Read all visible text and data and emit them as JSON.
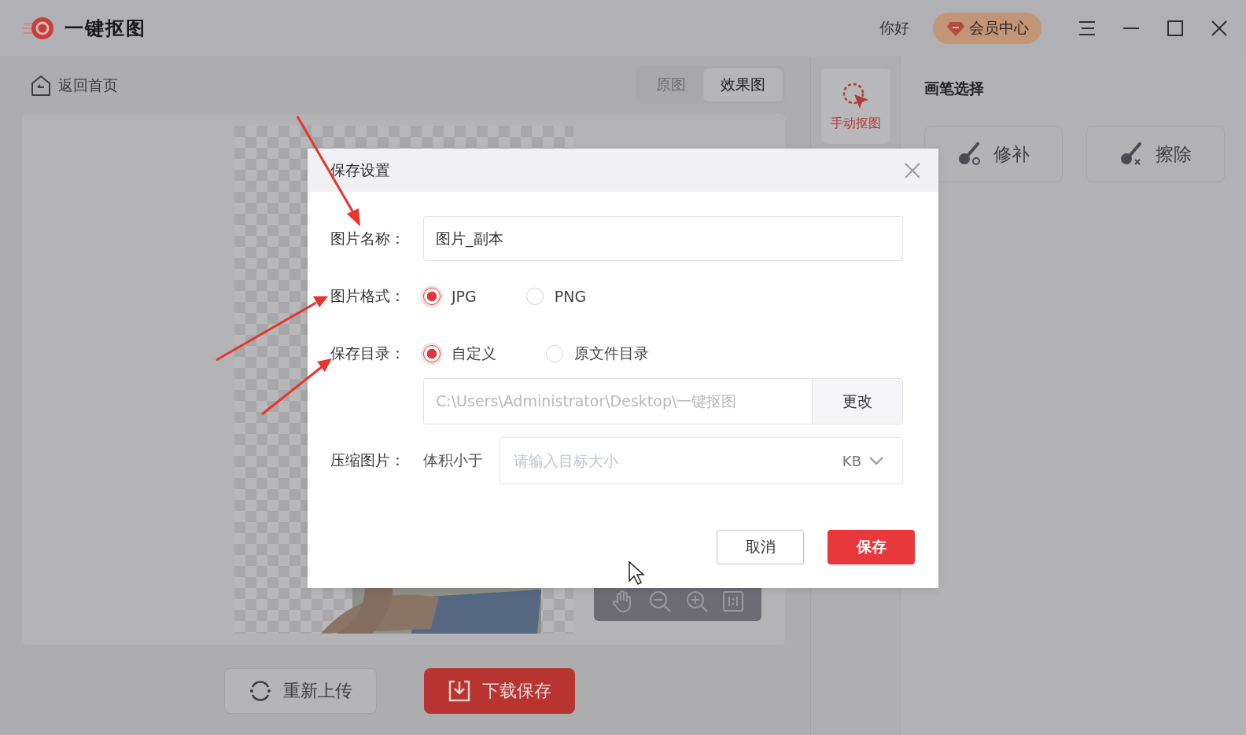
{
  "app": {
    "title": "一键抠图",
    "greeting": "你好",
    "vip_button": "会员中心"
  },
  "toolbar": {
    "back_link": "返回首页",
    "view_tabs": [
      {
        "label": "原图",
        "selected": false
      },
      {
        "label": "效果图",
        "selected": true
      }
    ]
  },
  "tools": [
    {
      "label": "手动抠图",
      "selected": true
    }
  ],
  "brush_panel": {
    "title": "画笔选择",
    "brushes": [
      {
        "label": "修补",
        "kind": "repair"
      },
      {
        "label": "擦除",
        "kind": "erase"
      }
    ]
  },
  "bottom_buttons": [
    {
      "label": "重新上传",
      "kind": "secondary"
    },
    {
      "label": "下载保存",
      "kind": "primary"
    }
  ],
  "dialog": {
    "title": "保存设置",
    "name_field": {
      "label": "图片名称：",
      "value": "图片_副本"
    },
    "format_field": {
      "label": "图片格式：",
      "options": [
        {
          "label": "JPG",
          "selected": true
        },
        {
          "label": "PNG",
          "selected": false
        }
      ]
    },
    "directory_field": {
      "label": "保存目录：",
      "options": [
        {
          "label": "自定义",
          "selected": true
        },
        {
          "label": "原文件目录",
          "selected": false
        }
      ],
      "path": "C:\\Users\\Administrator\\Desktop\\一键抠图",
      "change_button": "更改"
    },
    "compress_field": {
      "label": "压缩图片：",
      "prefix": "体积小于",
      "placeholder": "请输入目标大小",
      "unit": "KB"
    },
    "buttons": [
      {
        "label": "取消",
        "kind": "secondary"
      },
      {
        "label": "保存",
        "kind": "primary"
      }
    ]
  }
}
